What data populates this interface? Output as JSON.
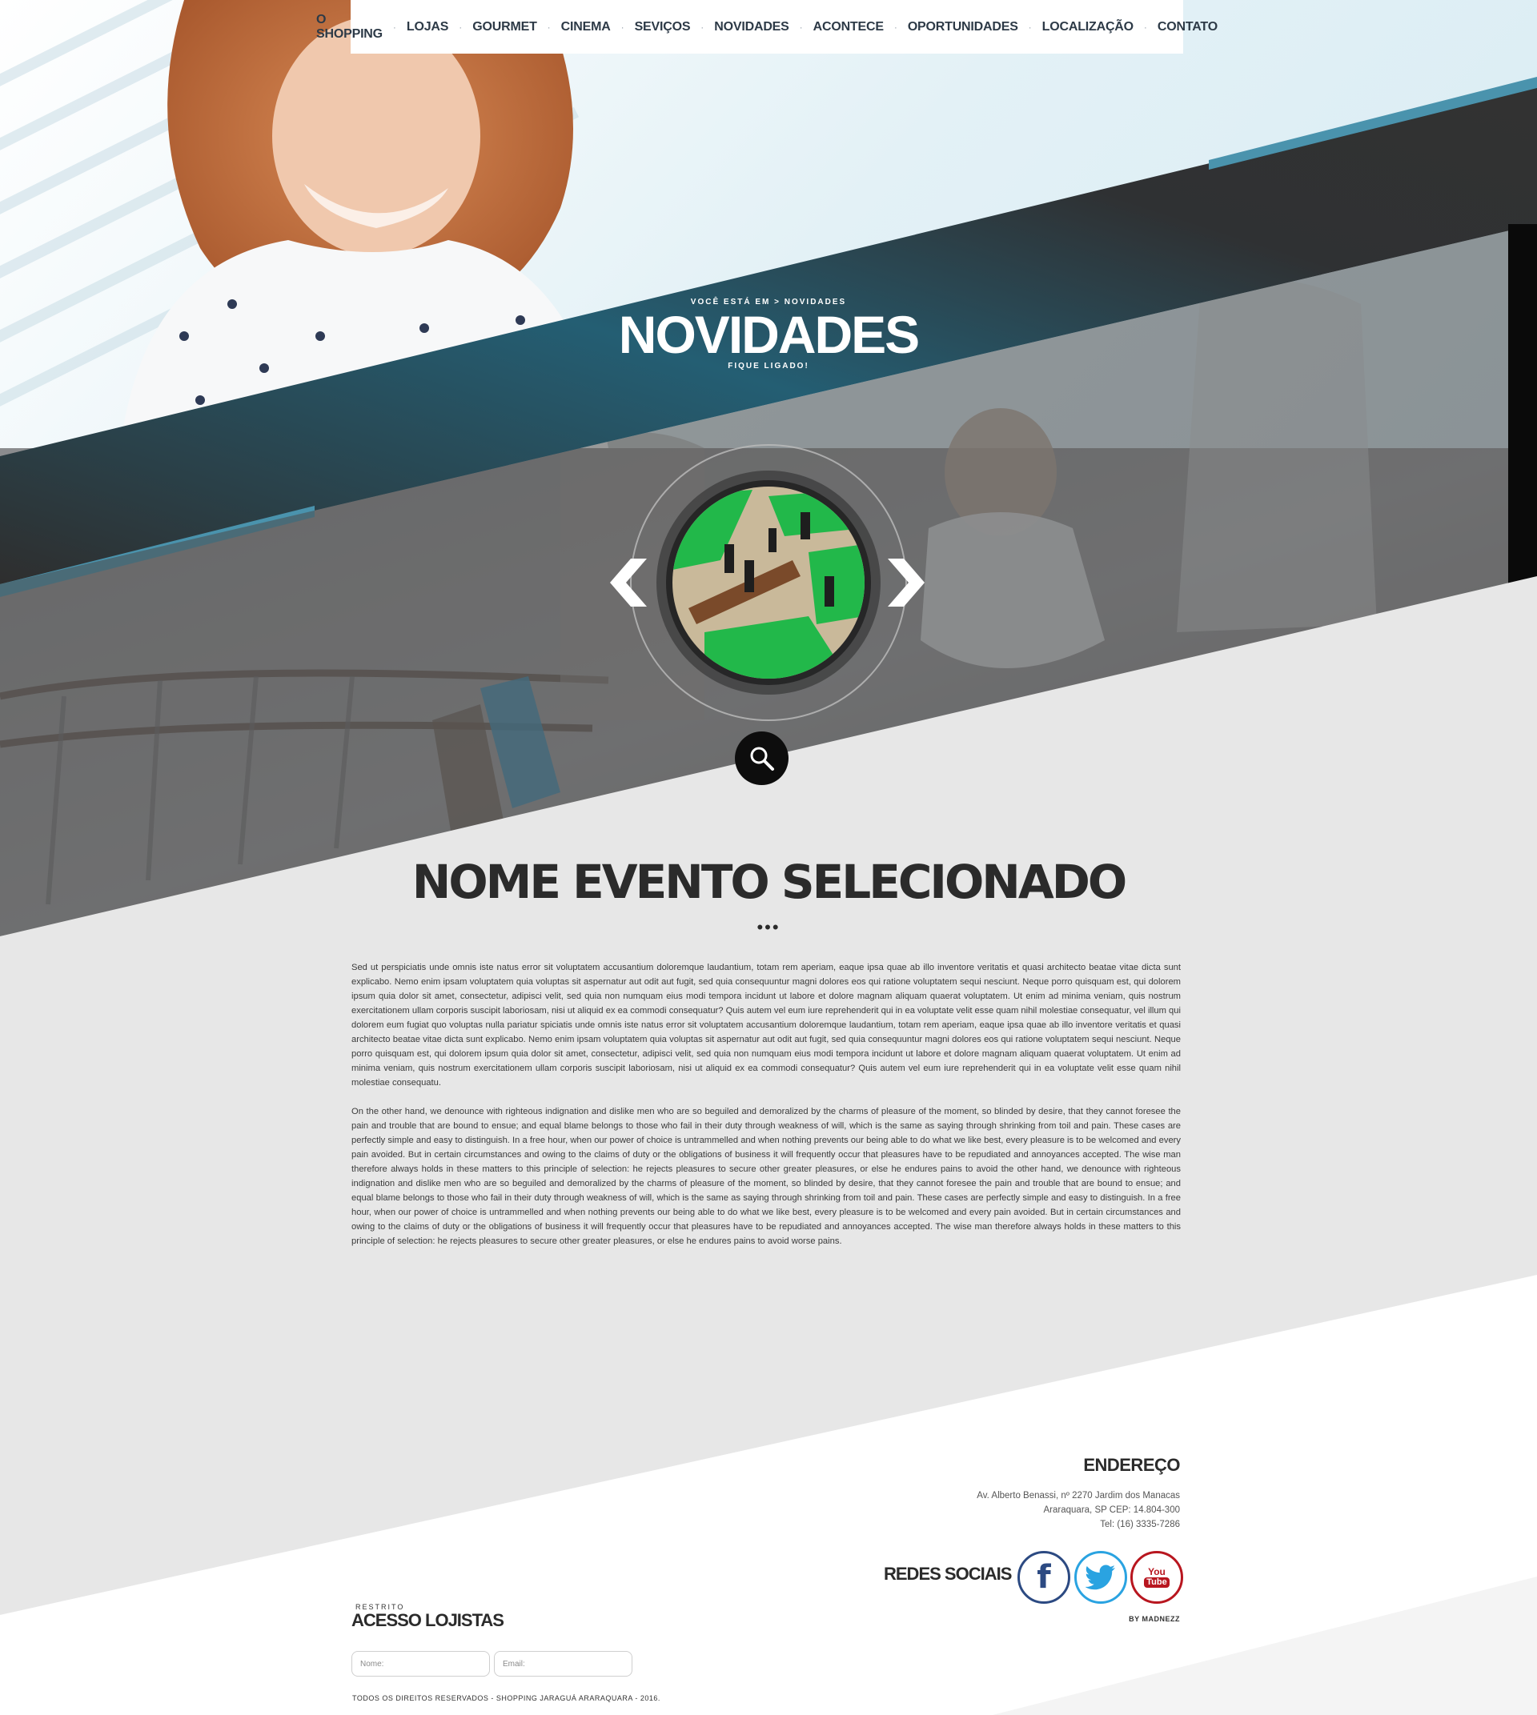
{
  "nav": {
    "items": [
      "O SHOPPING",
      "LOJAS",
      "GOURMET",
      "CINEMA",
      "SEVIÇOS",
      "NOVIDADES",
      "ACONTECE",
      "OPORTUNIDADES",
      "LOCALIZAÇÃO",
      "CONTATO"
    ],
    "separator": "·"
  },
  "hero": {
    "breadcrumb": "VOCÊ ESTÁ EM > NOVIDADES",
    "title": "NOVIDADES",
    "subtitle": "FIQUE LIGADO!"
  },
  "event": {
    "title": "NOME EVENTO SELECIONADO",
    "dots": "•••",
    "paragraphs": [
      "Sed ut perspiciatis unde omnis iste natus error sit voluptatem accusantium doloremque laudantium, totam rem aperiam, eaque ipsa quae ab illo inventore veritatis et quasi architecto beatae vitae dicta sunt explicabo. Nemo enim ipsam voluptatem quia voluptas sit aspernatur aut odit aut fugit, sed quia consequuntur magni dolores eos qui ratione voluptatem sequi nesciunt. Neque porro quisquam est, qui dolorem ipsum quia dolor sit amet, consectetur, adipisci velit, sed quia non numquam eius modi tempora incidunt ut labore et dolore magnam aliquam quaerat voluptatem. Ut enim ad minima veniam, quis nostrum exercitationem ullam corporis suscipit laboriosam, nisi ut aliquid ex ea commodi consequatur? Quis autem vel eum iure reprehenderit qui in ea voluptate velit esse quam nihil molestiae consequatur, vel illum qui dolorem eum fugiat quo voluptas nulla pariatur spiciatis unde omnis iste natus error sit voluptatem accusantium doloremque laudantium, totam rem aperiam, eaque ipsa quae ab illo inventore veritatis et quasi architecto beatae vitae dicta sunt explicabo. Nemo enim ipsam voluptatem quia voluptas sit aspernatur aut odit aut fugit, sed quia consequuntur magni dolores eos qui ratione voluptatem sequi nesciunt. Neque porro quisquam est, qui dolorem ipsum quia dolor sit amet, consectetur, adipisci velit, sed quia non numquam eius modi tempora incidunt ut labore et dolore magnam aliquam quaerat voluptatem. Ut enim ad minima veniam, quis nostrum exercitationem ullam corporis suscipit laboriosam, nisi ut aliquid ex ea commodi consequatur? Quis autem vel eum iure reprehenderit qui in ea voluptate velit esse quam nihil molestiae consequatu.",
      "On the other hand, we denounce with righteous indignation and dislike men who are so beguiled and demoralized by the charms of pleasure of the moment, so blinded by desire, that they cannot foresee the pain and trouble that are bound to ensue; and equal blame belongs to those who fail in their duty through weakness of will, which is the same as saying through shrinking from toil and pain. These cases are perfectly simple and easy to distinguish. In a free hour, when our power of choice is untrammelled and when nothing prevents our being able to do what we like best, every pleasure is to be welcomed and every pain avoided. But in certain circumstances and owing to the claims of duty or the obligations of business it will frequently occur that pleasures have to be repudiated and annoyances accepted. The wise man therefore always holds in these matters to this principle of selection: he rejects pleasures to secure other greater pleasures, or else he endures pains to avoid  the other hand, we denounce with righteous indignation and dislike men who are so beguiled and demoralized by the charms of pleasure of the moment, so blinded by desire, that they cannot foresee the pain and trouble that are bound to ensue; and equal blame belongs to those who fail in their duty through weakness of will, which is the same as saying through shrinking from toil and pain. These cases are perfectly simple and easy to distinguish. In a free hour, when our power of choice is untrammelled and when nothing prevents our being able to do what we like best, every pleasure is to be welcomed and every pain avoided. But in certain circumstances and owing to the claims of duty or the obligations of business it will frequently occur that pleasures have to be repudiated and annoyances accepted. The wise man therefore always holds in these matters to this principle of selection: he rejects pleasures to secure other greater pleasures, or else he endures pains to avoid worse pains."
    ]
  },
  "footer": {
    "address_title": "ENDEREÇO",
    "address_line1": "Av. Alberto Benassi, nº 2270 Jardim dos Manacas",
    "address_line2": "Araraquara, SP CEP: 14.804-300",
    "address_line3": "Tel: (16) 3335-7286",
    "social_title": "REDES SOCIAIS",
    "social_facebook_glyph": "f",
    "social_youtube_top": "You",
    "social_youtube_bottom": "Tube",
    "by": "BY MADNEZZ",
    "restricted_label": "RESTRITO",
    "access_title": "ACESSO LOJISTAS",
    "name_placeholder": "Nome:",
    "email_placeholder": "Email:",
    "copyright": "TODOS OS DIREITOS RESERVADOS - SHOPPING JARAGUÁ ARARAQUARA - 2016."
  },
  "colors": {
    "accent_blue": "#4a93ad",
    "dark_band": "#333333",
    "pool_green": "#22b84a",
    "facebook": "#2c4a82",
    "twitter": "#2aa3e1",
    "youtube": "#b8161f"
  },
  "icons": {
    "prev": "chevron-left-icon",
    "next": "chevron-right-icon",
    "search": "search-icon",
    "facebook": "facebook-icon",
    "twitter": "twitter-icon",
    "youtube": "youtube-icon"
  }
}
